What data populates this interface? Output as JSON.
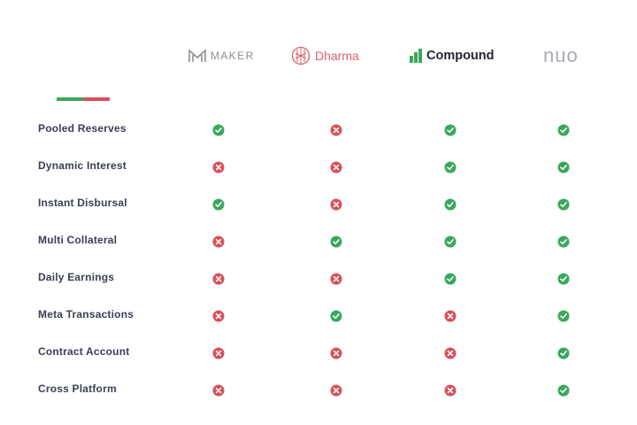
{
  "providers": [
    {
      "name": "MAKER"
    },
    {
      "name": "Dharma"
    },
    {
      "name": "Compound"
    },
    {
      "name": "nuo"
    }
  ],
  "colors": {
    "check": "#3aa85c",
    "cross": "#d9505a"
  },
  "icons": {
    "yes": "check-circle-icon",
    "no": "cross-circle-icon"
  },
  "features": [
    {
      "label": "Pooled Reserves",
      "support": [
        true,
        false,
        true,
        true
      ]
    },
    {
      "label": "Dynamic Interest",
      "support": [
        false,
        false,
        true,
        true
      ]
    },
    {
      "label": "Instant Disbursal",
      "support": [
        true,
        false,
        true,
        true
      ]
    },
    {
      "label": "Multi Collateral",
      "support": [
        false,
        true,
        true,
        true
      ]
    },
    {
      "label": "Daily Earnings",
      "support": [
        false,
        false,
        true,
        true
      ]
    },
    {
      "label": "Meta Transactions",
      "support": [
        false,
        true,
        false,
        true
      ]
    },
    {
      "label": "Contract Account",
      "support": [
        false,
        false,
        false,
        true
      ]
    },
    {
      "label": "Cross Platform",
      "support": [
        false,
        false,
        false,
        true
      ]
    }
  ]
}
